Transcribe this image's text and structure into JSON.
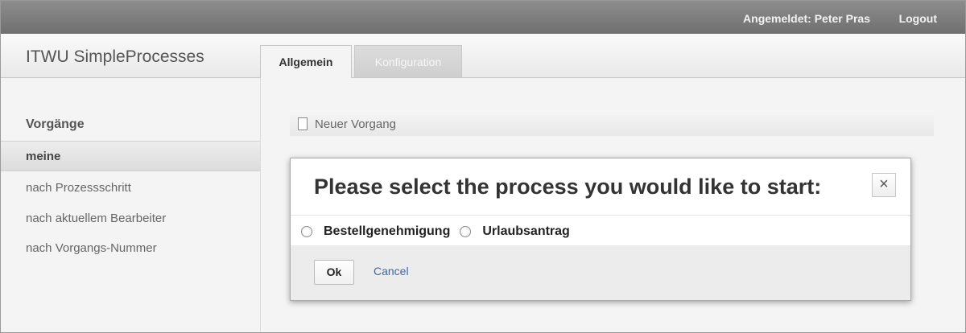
{
  "topbar": {
    "user_label": "Angemeldet: Peter Pras",
    "logout_label": "Logout"
  },
  "header": {
    "app_title": "ITWU SimpleProcesses",
    "tabs": [
      {
        "label": "Allgemein",
        "active": true
      },
      {
        "label": "Konfiguration",
        "active": false
      }
    ]
  },
  "sidebar": {
    "heading": "Vorgänge",
    "items": [
      {
        "label": "meine",
        "selected": true
      },
      {
        "label": "nach Prozessschritt",
        "selected": false
      },
      {
        "label": "nach aktuellem Bearbeiter",
        "selected": false
      },
      {
        "label": "nach Vorgangs-Nummer",
        "selected": false
      }
    ]
  },
  "main": {
    "new_label": "Neuer Vorgang",
    "new_icon": "document-icon"
  },
  "dialog": {
    "title": "Please select the process you would like to start:",
    "close_symbol": "×",
    "options": [
      {
        "label": "Bestellgenehmigung",
        "checked": false
      },
      {
        "label": "Urlaubsantrag",
        "checked": false
      }
    ],
    "ok_label": "Ok",
    "cancel_label": "Cancel"
  },
  "colors": {
    "topbar": "#7d7d7d",
    "link": "#3f67a8",
    "background": "#f4f4f4"
  }
}
